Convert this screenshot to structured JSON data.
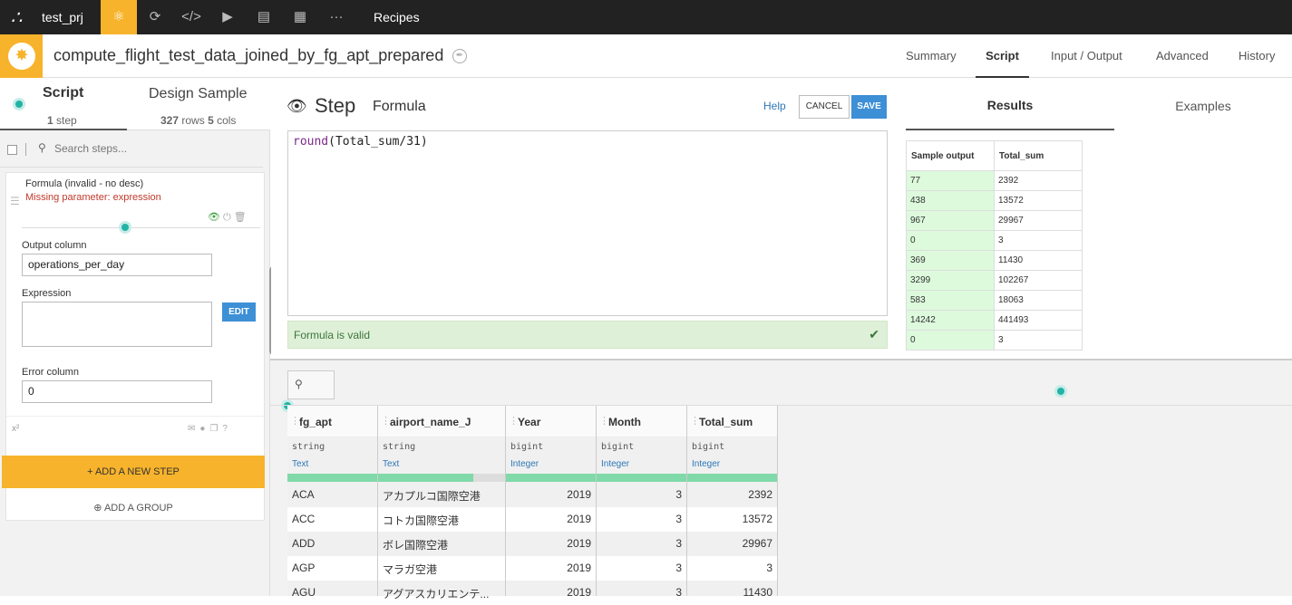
{
  "topnav": {
    "logo": "∴",
    "project": "test_prj",
    "icons": [
      "flow-icon",
      "refresh-icon",
      "code-icon",
      "play-icon",
      "datasets-icon",
      "dashboard-icon",
      "more-icon"
    ],
    "recipes_label": "Recipes"
  },
  "header": {
    "title": "compute_flight_test_data_joined_by_fg_apt_prepared",
    "tabs": [
      "Summary",
      "Script",
      "Input / Output",
      "Advanced",
      "History"
    ],
    "active_tab": "Script"
  },
  "left": {
    "script_tab": {
      "title": "Script",
      "count": "1",
      "count_label": "step"
    },
    "design_tab": {
      "title": "Design Sample",
      "rows": "327",
      "rows_label": "rows",
      "cols": "5",
      "cols_label": "cols"
    },
    "search_placeholder": "Search steps...",
    "step": {
      "name": "Formula (invalid - no desc)",
      "error": "Missing parameter: expression",
      "output_column_label": "Output column",
      "output_column_value": "operations_per_day",
      "expression_label": "Expression",
      "edit_label": "EDIT",
      "error_column_label": "Error column",
      "error_column_value": "0",
      "footer_label": "x²"
    },
    "add_step_label": "+ ADD A NEW STEP",
    "add_group_label": "ADD A GROUP"
  },
  "editor": {
    "step_label": "Step",
    "processor": "Formula",
    "help_label": "Help",
    "cancel_label": "CANCEL",
    "save_label": "SAVE",
    "code_fn": "round",
    "code_rest": "(Total_sum/31)",
    "valid_msg": "Formula is valid"
  },
  "results": {
    "tab_results": "Results",
    "tab_examples": "Examples",
    "headers": [
      "Sample output",
      "Total_sum"
    ],
    "rows": [
      [
        "77",
        "2392"
      ],
      [
        "438",
        "13572"
      ],
      [
        "967",
        "29967"
      ],
      [
        "0",
        "3"
      ],
      [
        "369",
        "11430"
      ],
      [
        "3299",
        "102267"
      ],
      [
        "583",
        "18063"
      ],
      [
        "14242",
        "441493"
      ],
      [
        "0",
        "3"
      ]
    ]
  },
  "grid": {
    "columns": [
      {
        "name": "fg_apt",
        "type": "string",
        "meaning": "Text"
      },
      {
        "name": "airport_name_J",
        "type": "string",
        "meaning": "Text"
      },
      {
        "name": "Year",
        "type": "bigint",
        "meaning": "Integer"
      },
      {
        "name": "Month",
        "type": "bigint",
        "meaning": "Integer"
      },
      {
        "name": "Total_sum",
        "type": "bigint",
        "meaning": "Integer"
      }
    ],
    "rows": [
      [
        "ACA",
        "アカプルコ国際空港",
        "2019",
        "3",
        "2392"
      ],
      [
        "ACC",
        "コトカ国際空港",
        "2019",
        "3",
        "13572"
      ],
      [
        "ADD",
        "ボレ国際空港",
        "2019",
        "3",
        "29967"
      ],
      [
        "AGP",
        "マラガ空港",
        "2019",
        "3",
        "3"
      ],
      [
        "AGU",
        "アグアスカリエンテ...",
        "2019",
        "3",
        "11430"
      ]
    ],
    "validity": [
      1,
      0.75,
      1,
      1,
      1
    ]
  }
}
